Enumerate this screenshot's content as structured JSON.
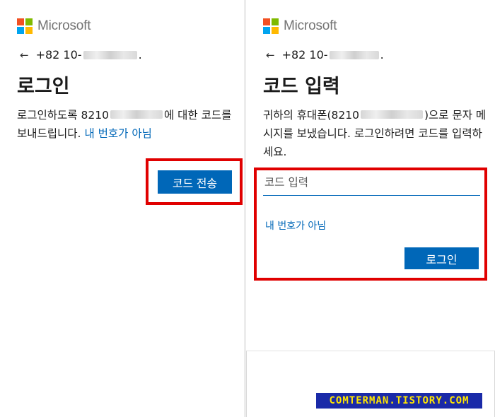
{
  "brand": {
    "name": "Microsoft",
    "colors": [
      "#f25022",
      "#7fba00",
      "#00a4ef",
      "#ffb900"
    ]
  },
  "left": {
    "back_icon": "←",
    "phone_prefix": "+82 10-",
    "phone_suffix": ".",
    "title": "로그인",
    "desc_part1": "로그인하도록 8210",
    "desc_part2": "에 대한 코드를 보내드립니다.",
    "not_mine_link": "내 번호가 아님",
    "send_button": "코드 전송"
  },
  "right": {
    "back_icon": "←",
    "phone_prefix": "+82 10-",
    "phone_suffix": ".",
    "title": "코드 입력",
    "desc_part1": "귀하의 휴대폰(8210",
    "desc_part2": ")으로 문자 메시지를 보냈습니다. 로그인하려면 코드를 입력하세요.",
    "code_placeholder": "코드 입력",
    "not_mine_link": "내 번호가 아님",
    "login_button": "로그인"
  },
  "watermark": "COMTERMAN.TISTORY.COM",
  "accent_color": "#0067b8",
  "highlight_color": "#e00000"
}
